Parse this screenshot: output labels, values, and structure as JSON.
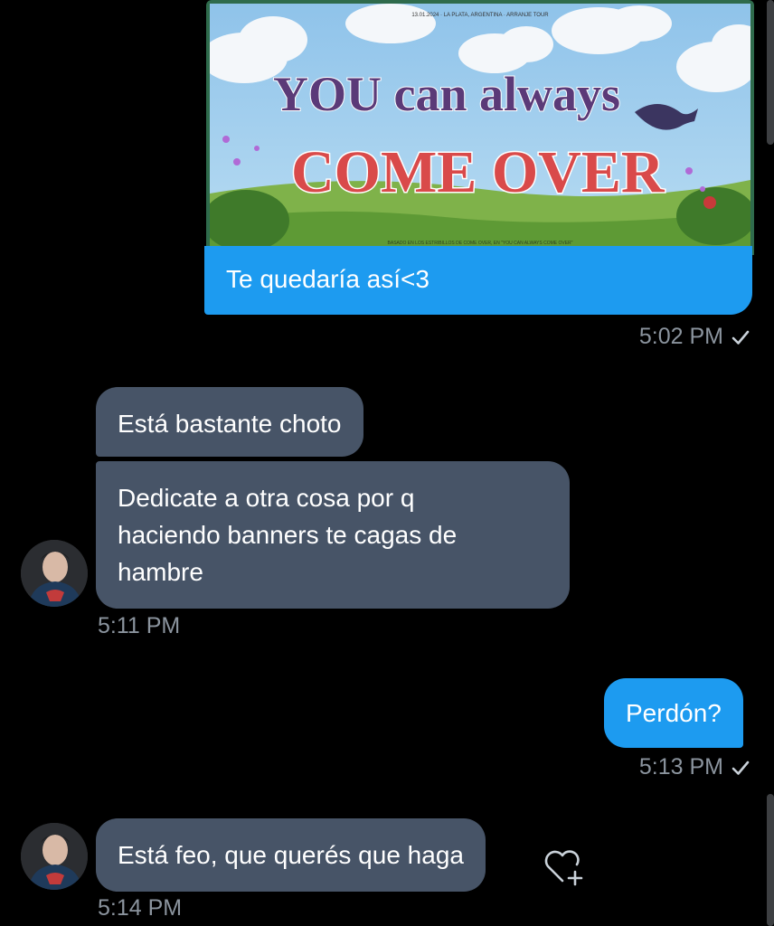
{
  "messages": [
    {
      "id": "m1",
      "direction": "outgoing",
      "type": "image+text",
      "image": {
        "top_small_text": "13.01.2024 · LA PLATA, ARGENTINA · ARRANJE TOUR",
        "headline_line1": "YOU can always",
        "headline_line2": "COME OVER",
        "bottom_small_text": "BASADO EN LOS ESTRIBILLOS DE COME OVER, EN \"YOU CAN ALWAYS COME OVER\""
      },
      "text": "Te quedaría así<3",
      "time": "5:02 PM"
    },
    {
      "id": "m2",
      "direction": "incoming",
      "text": "Está bastante choto"
    },
    {
      "id": "m3",
      "direction": "incoming",
      "lines": [
        "Dedicate a otra cosa por q",
        "haciendo banners te cagas de",
        "hambre"
      ],
      "time": "5:11 PM"
    },
    {
      "id": "m4",
      "direction": "outgoing",
      "text": "Perdón?",
      "time": "5:13 PM"
    },
    {
      "id": "m5",
      "direction": "incoming",
      "text": "Está feo, que querés que haga",
      "time": "5:14 PM"
    }
  ],
  "icons": {
    "read_receipt": "checkmark-icon",
    "reaction": "heart-plus-icon",
    "avatar": "avatar"
  },
  "colors": {
    "background": "#000000",
    "outgoing_bubble": "#1d9bf0",
    "incoming_bubble": "#475467",
    "timestamp": "#8b949e"
  }
}
